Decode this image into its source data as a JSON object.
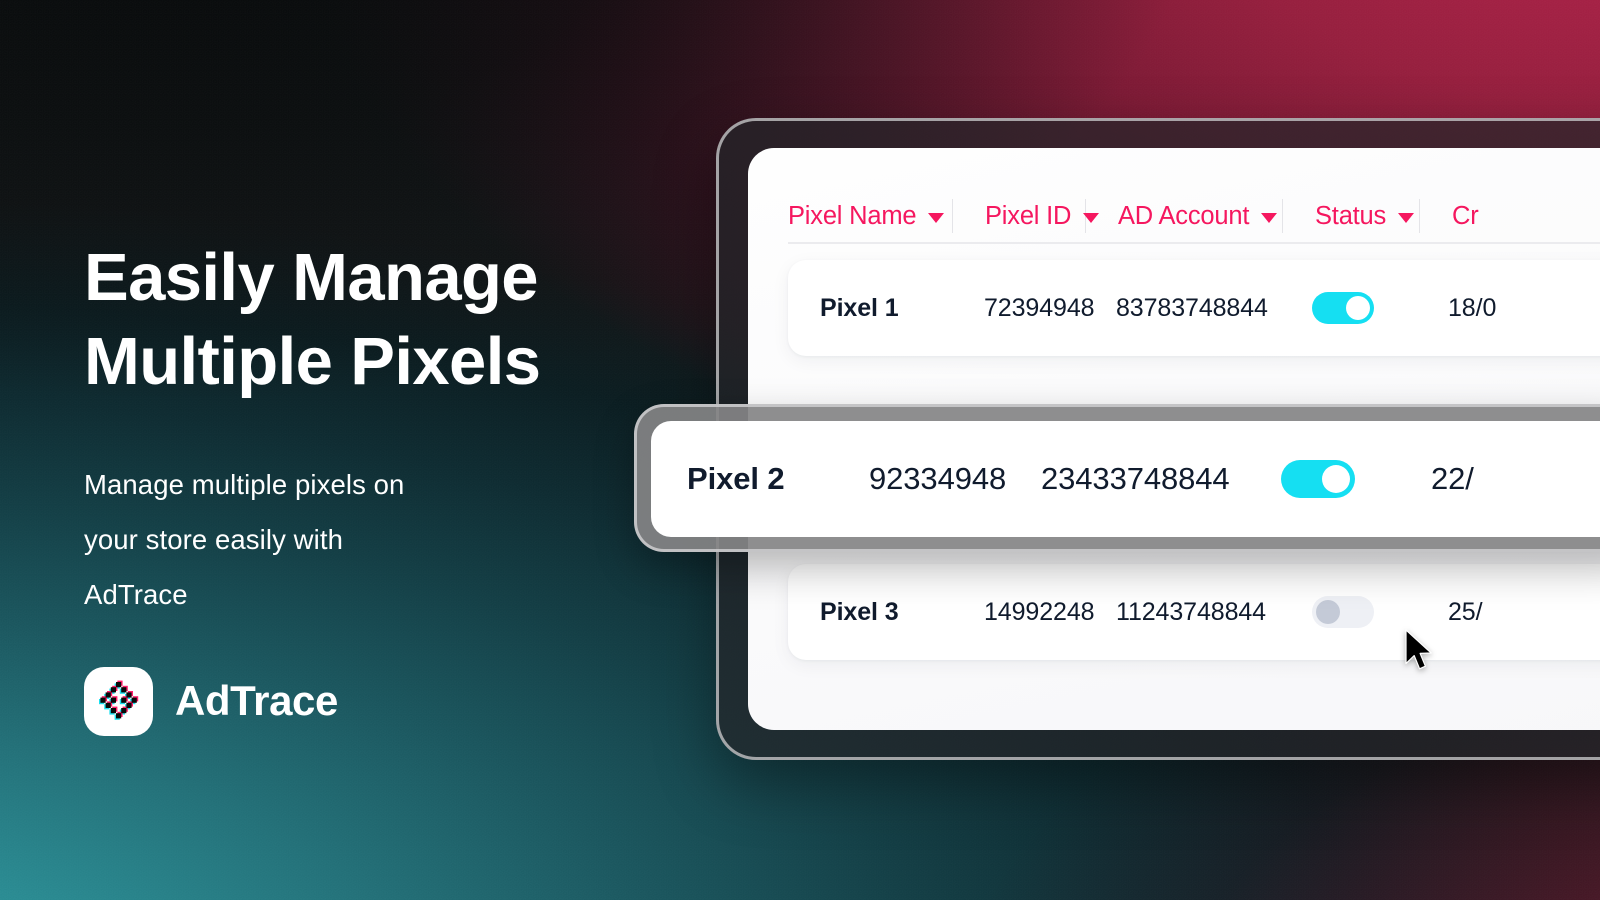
{
  "hero": {
    "headline": "Easily Manage\nMultiple Pixels",
    "subcopy": "Manage multiple pixels on\nyour store easily with\nAdTrace",
    "brand_name": "AdTrace",
    "brand_icon": "adtrace-pixel-diamond-icon"
  },
  "colors": {
    "accent_pink": "#f5175f",
    "toggle_on": "#15dff2",
    "toggle_off_track": "#eef0f5",
    "toggle_off_knob": "#c4cad7",
    "text_dark": "#101b2d",
    "bg_teal": "#2b8c93",
    "bg_crimson": "#a62246"
  },
  "table": {
    "columns": [
      {
        "label": "Pixel Name",
        "sort_icon": "chevron-down-icon"
      },
      {
        "label": "Pixel ID",
        "sort_icon": "chevron-down-icon"
      },
      {
        "label": "AD Account",
        "sort_icon": "chevron-down-icon"
      },
      {
        "label": "Status",
        "sort_icon": "chevron-down-icon"
      },
      {
        "label": "Cr",
        "sort_icon": "chevron-down-icon"
      }
    ],
    "rows": [
      {
        "pixel_name": "Pixel 1",
        "pixel_id": "72394948",
        "ad_account": "83783748844",
        "status": "on",
        "created": "18/0"
      },
      {
        "pixel_name": "Pixel 2",
        "pixel_id": "92334948",
        "ad_account": "23433748844",
        "status": "on",
        "created": "22/"
      },
      {
        "pixel_name": "Pixel 3",
        "pixel_id": "14992248",
        "ad_account": "11243748844",
        "status": "off",
        "created": "25/"
      }
    ]
  },
  "cursor": {
    "icon": "mouse-pointer-icon"
  }
}
